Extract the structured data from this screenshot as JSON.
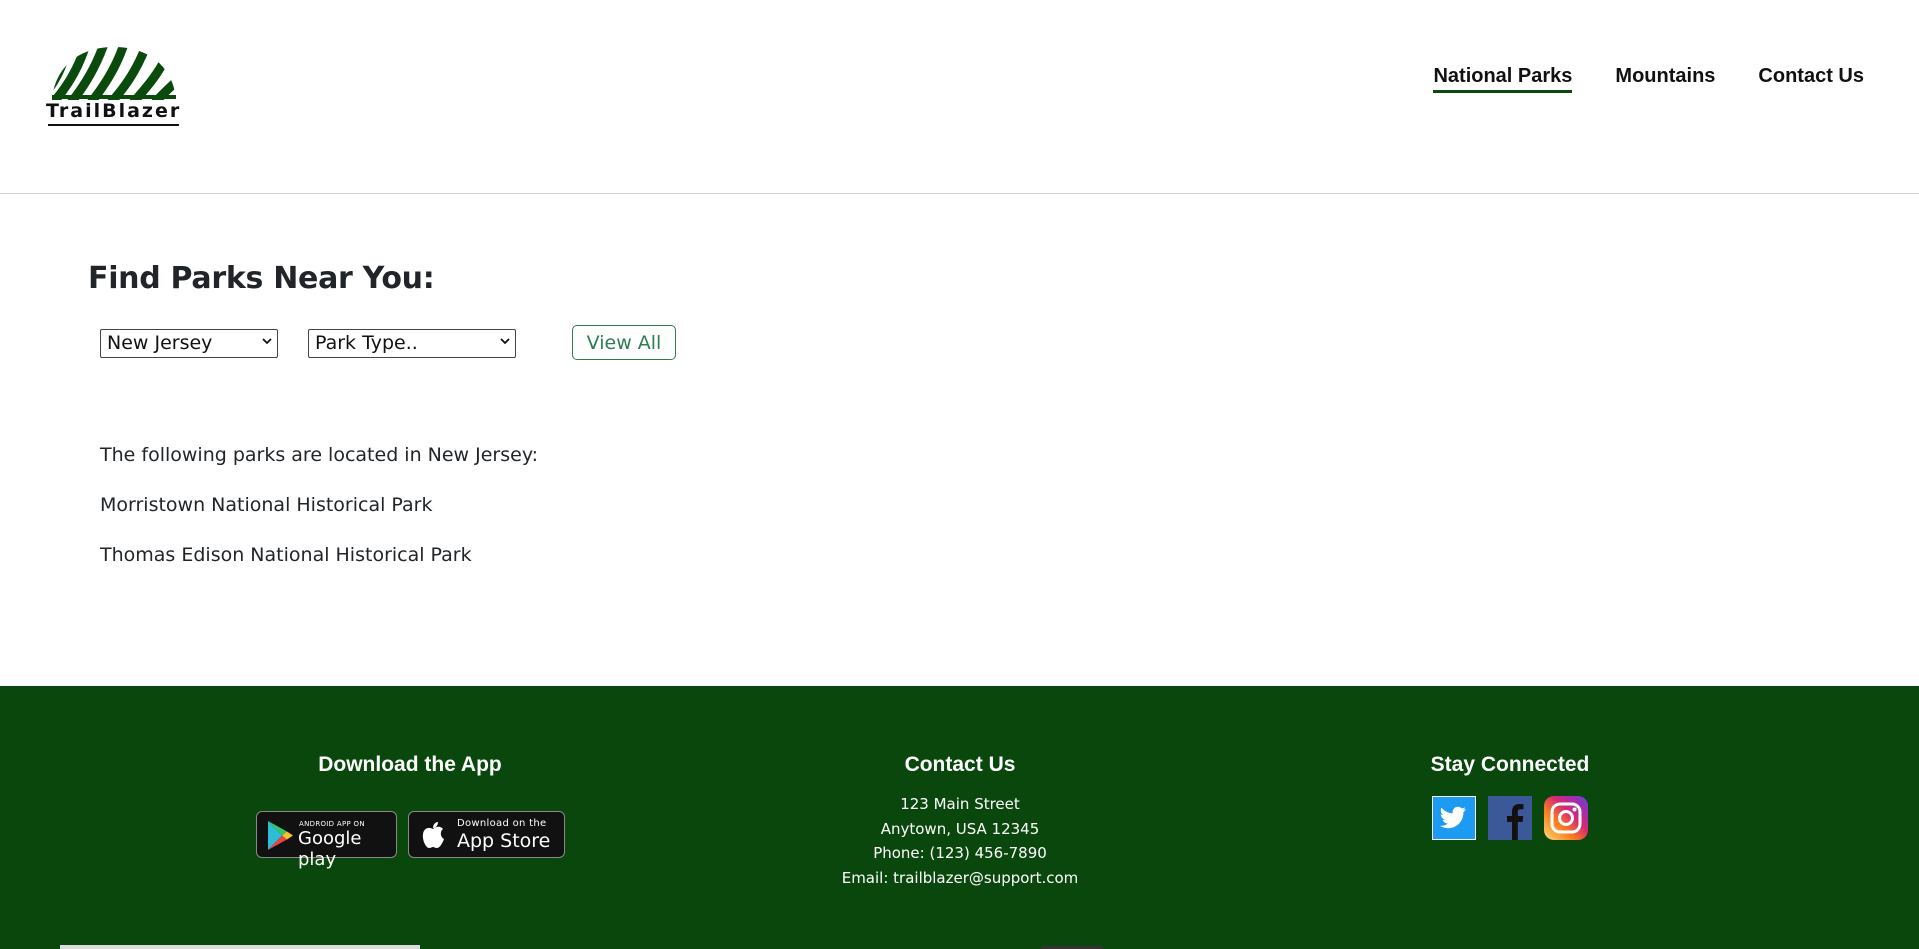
{
  "brand": {
    "name": "TrailBlazer",
    "color": "#0a4a0c"
  },
  "nav": {
    "items": [
      {
        "label": "National Parks",
        "active": true
      },
      {
        "label": "Mountains",
        "active": false
      },
      {
        "label": "Contact Us",
        "active": false
      }
    ]
  },
  "finder": {
    "title": "Find Parks Near You:",
    "state_select": "New Jersey",
    "type_select": "Park Type..",
    "view_all_label": "View All"
  },
  "results": {
    "intro": "The following parks are located in New Jersey:",
    "parks": [
      "Morristown National Historical Park",
      "Thomas Edison National Historical Park"
    ]
  },
  "footer": {
    "background": "#0a470c",
    "app": {
      "title": "Download the App",
      "google": {
        "small": "ANDROID APP ON",
        "big": "Google play"
      },
      "apple": {
        "small": "Download on the",
        "big": "App Store"
      }
    },
    "contact": {
      "title": "Contact Us",
      "address1": "123 Main Street",
      "address2": "Anytown, USA 12345",
      "phone": "Phone: (123) 456-7890",
      "email": "Email: trailblazer@support.com"
    },
    "social": {
      "title": "Stay Connected",
      "icons": [
        "twitter-icon",
        "facebook-icon",
        "instagram-icon"
      ]
    }
  }
}
